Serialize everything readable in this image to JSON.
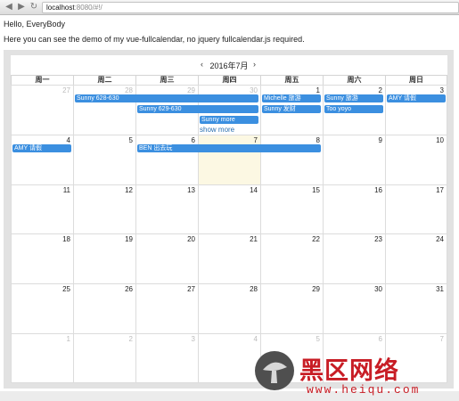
{
  "browser": {
    "url_host": "localhost",
    "url_rest": ":8080/#!/",
    "back_icon": "arrow-left-icon",
    "forward_icon": "arrow-right-icon",
    "reload_icon": "reload-icon"
  },
  "page": {
    "greeting": "Hello, EveryBody",
    "intro": "Here you can see the demo of my vue-fullcalendar, no jquery fullcalendar.js required."
  },
  "calendar": {
    "title": "2016年7月",
    "prev_label": "‹",
    "next_label": "›",
    "weekdays": [
      "周一",
      "周二",
      "周三",
      "周四",
      "周五",
      "周六",
      "周日"
    ],
    "weeks": [
      [
        "27",
        "28",
        "29",
        "30",
        "1",
        "2",
        "3"
      ],
      [
        "4",
        "5",
        "6",
        "7",
        "8",
        "9",
        "10"
      ],
      [
        "11",
        "12",
        "13",
        "14",
        "15",
        "16",
        "17"
      ],
      [
        "18",
        "19",
        "20",
        "21",
        "22",
        "23",
        "24"
      ],
      [
        "25",
        "26",
        "27",
        "28",
        "29",
        "30",
        "31"
      ],
      [
        "1",
        "2",
        "3",
        "4",
        "5",
        "6",
        "7"
      ]
    ],
    "other_month": [
      [
        true,
        true,
        true,
        true,
        false,
        false,
        false
      ],
      [
        false,
        false,
        false,
        false,
        false,
        false,
        false
      ],
      [
        false,
        false,
        false,
        false,
        false,
        false,
        false
      ],
      [
        false,
        false,
        false,
        false,
        false,
        false,
        false
      ],
      [
        false,
        false,
        false,
        false,
        false,
        false,
        false
      ],
      [
        true,
        true,
        true,
        true,
        true,
        true,
        true
      ]
    ],
    "today": {
      "week": 1,
      "day": 3
    },
    "events": [
      {
        "title": "Sunny 628-630",
        "week": 0,
        "start": 1,
        "span": 3,
        "row": 0
      },
      {
        "title": "Sunny 629-630",
        "week": 0,
        "start": 2,
        "span": 2,
        "row": 1
      },
      {
        "title": "Sunny more",
        "week": 0,
        "start": 3,
        "span": 1,
        "row": 2
      },
      {
        "title": "Michelle 旅游",
        "week": 0,
        "start": 4,
        "span": 1,
        "row": 0
      },
      {
        "title": "Sunny 发财",
        "week": 0,
        "start": 4,
        "span": 1,
        "row": 1
      },
      {
        "title": "Sunny 旅游",
        "week": 0,
        "start": 5,
        "span": 1,
        "row": 0
      },
      {
        "title": "Too yoyo",
        "week": 0,
        "start": 5,
        "span": 1,
        "row": 1
      },
      {
        "title": "AMY 请假",
        "week": 0,
        "start": 6,
        "span": 1,
        "row": 0
      },
      {
        "title": "AMY 请假",
        "week": 1,
        "start": 0,
        "span": 1,
        "row": 0
      },
      {
        "title": "BEN 出去玩",
        "week": 1,
        "start": 2,
        "span": 3,
        "row": 0
      }
    ],
    "more": {
      "label": "show more",
      "week": 0,
      "day": 3
    }
  },
  "watermark": {
    "text": "黑区网络",
    "url": "www.heiqu.com",
    "icon": "mushroom-logo-icon"
  }
}
